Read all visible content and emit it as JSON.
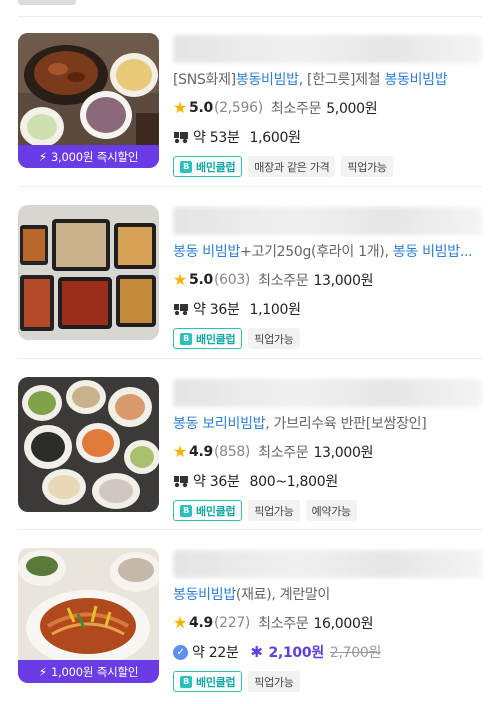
{
  "stores": [
    {
      "menu_parts": [
        {
          "text": "[SNS화제]",
          "hl": false
        },
        {
          "text": "봉동비빔밥",
          "hl": true
        },
        {
          "text": ", [한그릇]제철 ",
          "hl": false
        },
        {
          "text": "봉동비빔밥",
          "hl": true
        }
      ],
      "rating": "5.0",
      "review_count": "(2,596)",
      "min_order_label": "최소주문",
      "min_order": "5,000원",
      "delivery_time": "약 53분",
      "delivery_fee": "1,600원",
      "discount": "3,000원 즉시할인",
      "tags": [
        "배민클럽",
        "매장과 같은 가격",
        "픽업가능"
      ]
    },
    {
      "menu_parts": [
        {
          "text": "봉동 비빔밥",
          "hl": true
        },
        {
          "text": "+고기250g(후라이 1개), ",
          "hl": false
        },
        {
          "text": "봉동 비빔밥...",
          "hl": true
        }
      ],
      "rating": "5.0",
      "review_count": "(603)",
      "min_order_label": "최소주문",
      "min_order": "13,000원",
      "delivery_time": "약 36분",
      "delivery_fee": "1,100원",
      "discount": "",
      "tags": [
        "배민클럽",
        "픽업가능"
      ]
    },
    {
      "menu_parts": [
        {
          "text": "봉동 보리",
          "hl": true
        },
        {
          "text": "비빔밥",
          "hl": true
        },
        {
          "text": ", 가브리수육 반판[보쌈장인]",
          "hl": false
        }
      ],
      "rating": "4.9",
      "review_count": "(858)",
      "min_order_label": "최소주문",
      "min_order": "13,000원",
      "delivery_time": "약 36분",
      "delivery_fee": "800~1,800원",
      "discount": "",
      "tags": [
        "배민클럽",
        "픽업가능",
        "예약가능"
      ]
    },
    {
      "menu_parts": [
        {
          "text": "봉동비빔밥",
          "hl": true
        },
        {
          "text": "(재료), 계란말이",
          "hl": false
        }
      ],
      "rating": "4.9",
      "review_count": "(227)",
      "min_order_label": "최소주문",
      "min_order": "16,000원",
      "delivery_time": "약 22분",
      "delivery_fee": "2,100원",
      "delivery_fee_original": "2,700원",
      "discount": "1,000원 즉시할인",
      "tags": [
        "배민클럽",
        "픽업가능"
      ]
    }
  ],
  "colors": {
    "discount_bar": "#6a3ce6",
    "highlight": "#2f7fd9",
    "club_teal": "#2ac1bc",
    "star": "#f6b400"
  },
  "icons": {
    "star": "star-icon",
    "delivery": "motorcycle-icon",
    "bolt": "lightning-icon",
    "club": "baemin-club-icon"
  }
}
